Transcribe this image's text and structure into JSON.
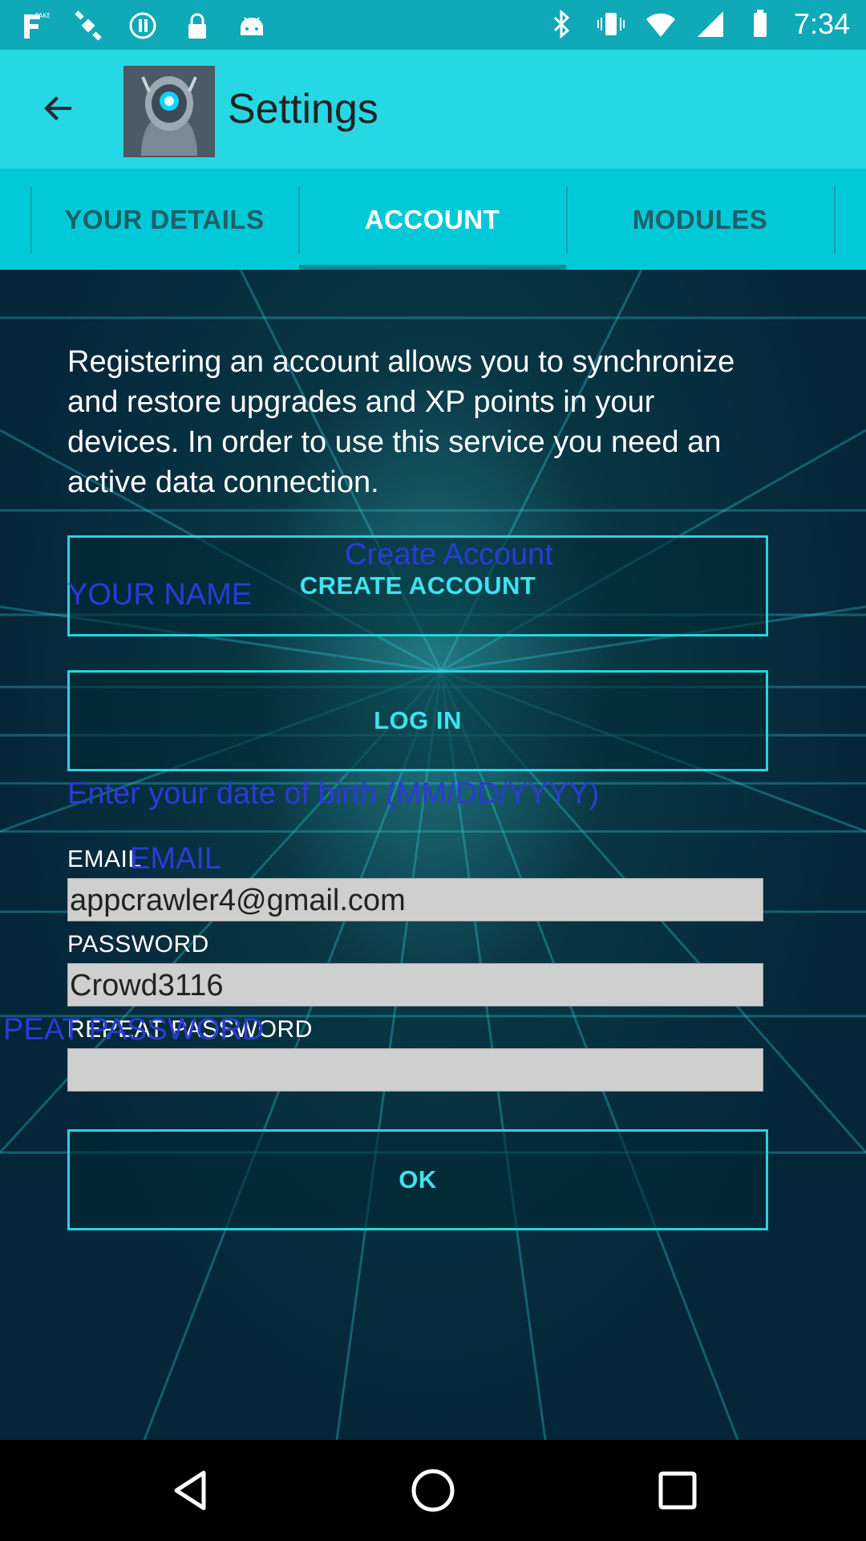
{
  "status_bar": {
    "time": "7:34",
    "icons": [
      "fake-gps-icon",
      "satellite-icon",
      "circle-record-icon",
      "lock-icon",
      "android-icon",
      "bluetooth-icon",
      "vibrate-icon",
      "wifi-icon",
      "signal-icon",
      "battery-icon"
    ]
  },
  "app_bar": {
    "title": "Settings",
    "back_icon": "arrow-back-icon",
    "logo_icon": "robot-logo-icon"
  },
  "tabs": [
    {
      "label": "YOUR DETAILS",
      "active": false
    },
    {
      "label": "ACCOUNT",
      "active": true
    },
    {
      "label": "MODULES",
      "active": false
    }
  ],
  "account": {
    "description": "Registering an account allows you to synchronize and restore upgrades and XP points in your devices. In order to use this service you need an active data connection.",
    "create_account_label": "CREATE ACCOUNT",
    "create_account_overlay": "Create Account",
    "your_name_overlay": "YOUR NAME",
    "login_label": "LOG IN",
    "dob_overlay": "Enter your date of birth (MM/DD/YYYY)",
    "email_label": "EMAIL",
    "email_overlay": "EMAIL",
    "email_value": "appcrawler4@gmail.com",
    "password_label": "PASSWORD",
    "password_value": "Crowd3116",
    "repeat_password_label": "REPEAT PASSWORD",
    "repeat_password_overlay": "PEAT PASSWORD",
    "repeat_password_value": "",
    "ok_label": "OK"
  },
  "nav_bar": {
    "icons": [
      "back-triangle-icon",
      "home-circle-icon",
      "recents-square-icon"
    ]
  },
  "colors": {
    "status_bar": "#0fa9b7",
    "app_bar": "#26d8e3",
    "tabs": "#00c9d7",
    "accent_text": "#3fe3ef",
    "overlay_blue": "#2b3bd8"
  }
}
